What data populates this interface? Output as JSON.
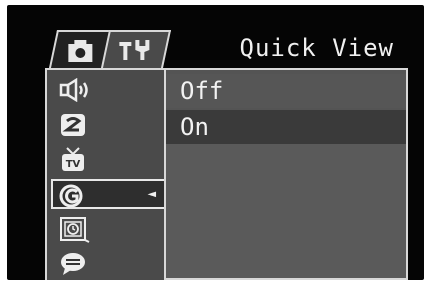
{
  "header": {
    "title": "Quick View"
  },
  "tabs": [
    {
      "icon": "camera-icon",
      "active": false
    },
    {
      "icon": "tools-icon",
      "active": true
    }
  ],
  "sidebar": {
    "items": [
      {
        "icon": "speaker-icon"
      },
      {
        "icon": "stabilizer-icon"
      },
      {
        "icon": "tv-icon"
      },
      {
        "icon": "quick-view-icon",
        "selected": true,
        "indicator": "◄"
      },
      {
        "icon": "clock-icon"
      },
      {
        "icon": "chat-icon"
      }
    ]
  },
  "options": {
    "items": [
      {
        "label": "Off"
      },
      {
        "label": "On",
        "highlighted": true
      }
    ]
  },
  "colors": {
    "screen_bg": "#050505",
    "panel_bg": "#545454",
    "highlight_bg": "#3a3a3a",
    "text": "#f2f2f2",
    "border": "#d8d8d8"
  }
}
